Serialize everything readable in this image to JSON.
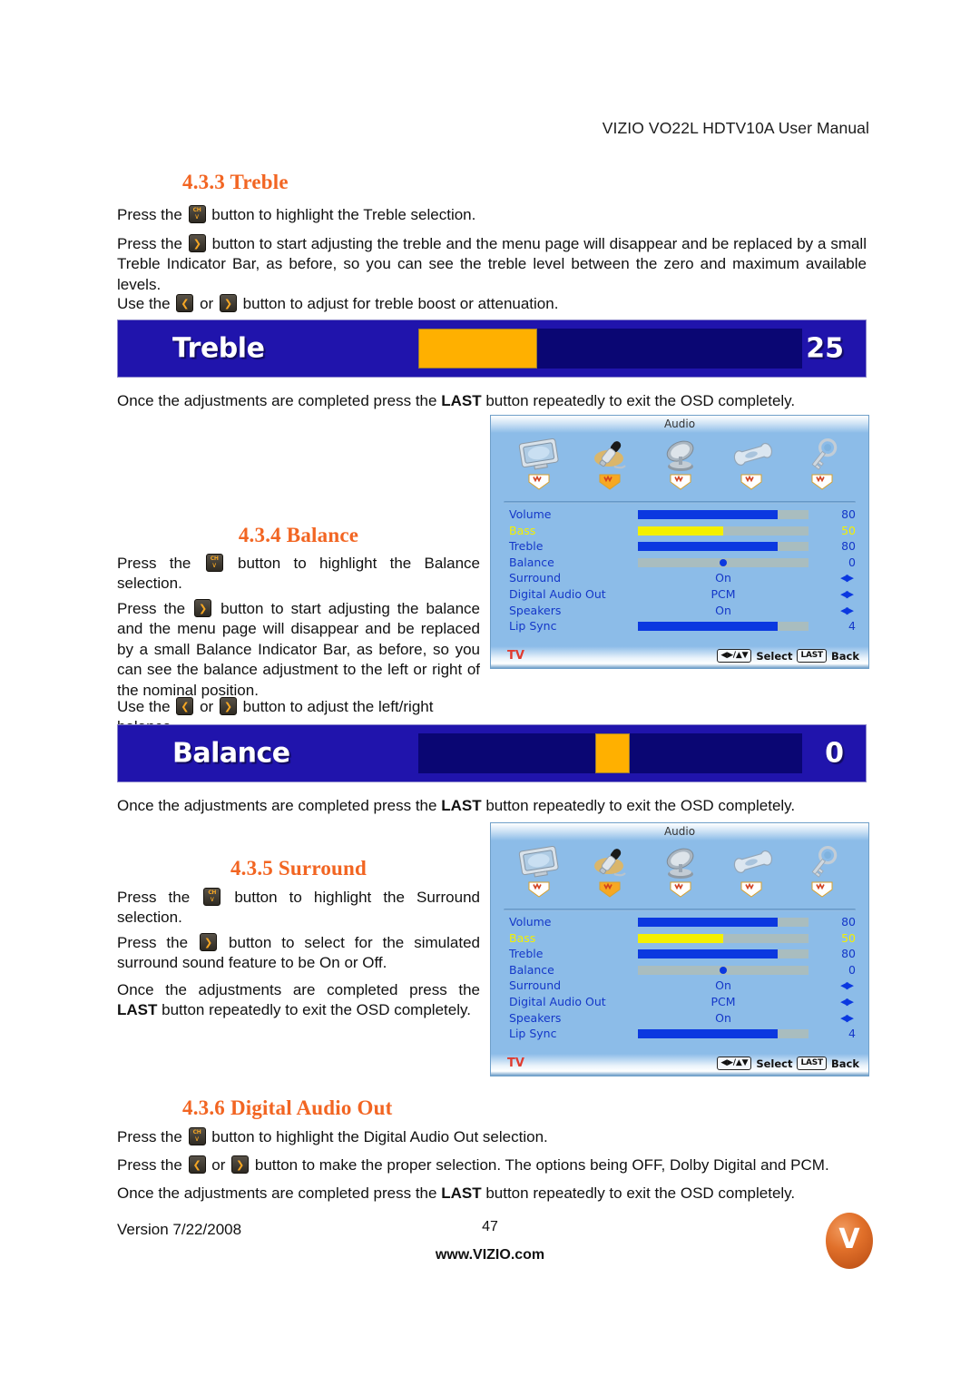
{
  "header": {
    "title": "VIZIO VO22L HDTV10A User Manual"
  },
  "sections": {
    "treble": {
      "heading": "4.3.3 Treble",
      "p1_a": "Press the",
      "p1_b": "button to highlight the Treble selection.",
      "p2_a": "Press the",
      "p2_b": "button to start adjusting the treble and the menu page will disappear and be replaced by a small Treble Indicator Bar, as before, so you can see the treble level between the zero and maximum available levels.",
      "p3_a": "Use the",
      "p3_or": "or",
      "p3_b": "button to adjust for treble boost or attenuation.",
      "closing_a": "Once the adjustments are completed press the",
      "closing_bold": "LAST",
      "closing_b": "button repeatedly to exit the OSD completely."
    },
    "balance": {
      "heading": "4.3.4 Balance",
      "p1_a": "Press the",
      "p1_b": "button to highlight the Balance selection.",
      "p2_a": "Press the",
      "p2_b": "button to start adjusting the balance and the menu page will disappear and be replaced by a small Balance Indicator Bar, as before, so you can see the balance adjustment to the left or right of the nominal position.",
      "p3_a": "Use the",
      "p3_or": "or",
      "p3_b": "button to adjust the left/right balance.",
      "closing_a": "Once the adjustments are completed press the",
      "closing_bold": "LAST",
      "closing_b": "button repeatedly to exit the OSD completely."
    },
    "surround": {
      "heading": "4.3.5 Surround",
      "p1_a": "Press the",
      "p1_b": "button to highlight the Surround selection.",
      "p2_a": "Press the",
      "p2_b": "button to select for the simulated surround sound feature to be On or Off.",
      "p3_a": "Once the adjustments are completed press the",
      "p3_bold": "LAST",
      "p3_b": "button repeatedly to exit the OSD completely."
    },
    "digital_audio_out": {
      "heading": "4.3.6 Digital Audio Out",
      "p1_a": "Press the",
      "p1_b": "button to highlight the Digital Audio Out selection.",
      "p2_a": "Press the",
      "p2_or": "or",
      "p2_b": "button to make the proper selection. The options being OFF, Dolby Digital and PCM.",
      "closing_a": "Once the adjustments are completed press the",
      "closing_bold": "LAST",
      "closing_b": "button repeatedly to exit the OSD completely."
    }
  },
  "indicator_bars": [
    {
      "name": "treble-indicator-bar",
      "label": "Treble",
      "value": "25",
      "fill_percent": 31,
      "fill_offset_percent": 0,
      "bar_bg": "#2014AC",
      "track_color": "#0A0673",
      "fill_color": "#FFB000"
    },
    {
      "name": "balance-indicator-bar",
      "label": "Balance",
      "value": "0",
      "fill_percent": 9,
      "fill_offset_percent": 46,
      "bar_bg": "#2014AC",
      "track_color": "#0A0673",
      "fill_color": "#FFB000"
    }
  ],
  "osd": {
    "title": "Audio",
    "categories": [
      {
        "icon": "tv-monitor-icon",
        "label": "picture",
        "active": false
      },
      {
        "icon": "microphone-icon",
        "label": "audio",
        "active": true
      },
      {
        "icon": "satellite-dish-icon",
        "label": "tuner",
        "active": false
      },
      {
        "icon": "wrench-icon",
        "label": "setup",
        "active": false
      },
      {
        "icon": "key-icon",
        "label": "parental",
        "active": false
      }
    ],
    "rows": [
      {
        "label": "Volume",
        "type": "bar",
        "value": "80",
        "fill": 82,
        "selected": false
      },
      {
        "label": "Bass",
        "type": "bar",
        "value": "50",
        "fill": 50,
        "selected": true
      },
      {
        "label": "Treble",
        "type": "bar",
        "value": "80",
        "fill": 82,
        "selected": false
      },
      {
        "label": "Balance",
        "type": "knob",
        "value": "0",
        "fill": 50,
        "selected": false
      },
      {
        "label": "Surround",
        "type": "option",
        "value": "On",
        "selected": false
      },
      {
        "label": "Digital Audio Out",
        "type": "option",
        "value": "PCM",
        "selected": false
      },
      {
        "label": "Speakers",
        "type": "option",
        "value": "On",
        "selected": false
      },
      {
        "label": "Lip Sync",
        "type": "bar",
        "value": "4",
        "fill": 82,
        "selected": false
      }
    ],
    "footer": {
      "source": "TV",
      "select_label": "Select",
      "last_key": "LAST",
      "back_label": "Back"
    }
  },
  "footer": {
    "version": "Version 7/22/2008",
    "page_number": "47",
    "website": "www.VIZIO.com",
    "logo_letter": "V"
  }
}
